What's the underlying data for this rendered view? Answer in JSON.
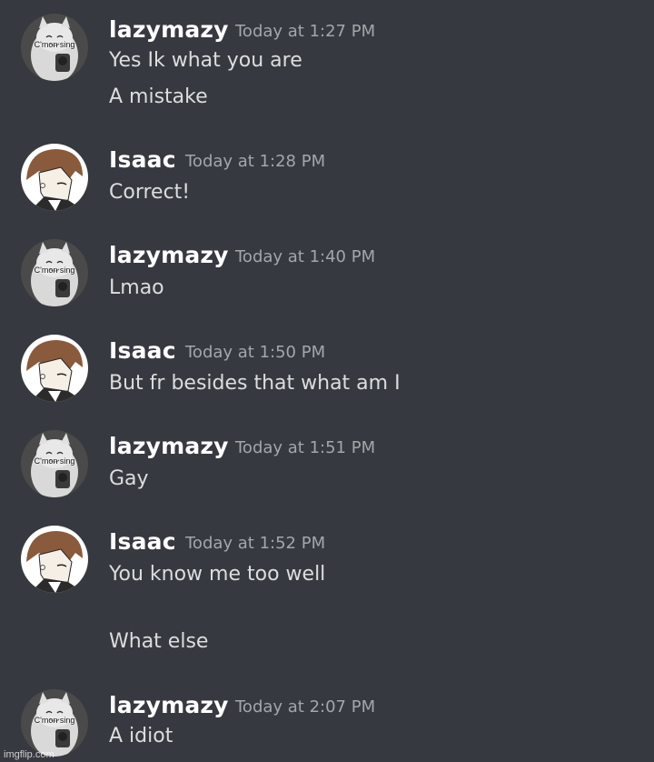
{
  "messages": [
    {
      "author": "lazymazy",
      "avatar": "cat-avatar",
      "time": "Today at 1:27 PM",
      "lines": [
        "Yes Ik what you are",
        "A mistake"
      ]
    },
    {
      "author": "Isaac",
      "avatar": "anime-avatar",
      "time": "Today at 1:28 PM",
      "lines": [
        "Correct!"
      ]
    },
    {
      "author": "lazymazy",
      "avatar": "cat-avatar",
      "time": "Today at 1:40 PM",
      "lines": [
        "Lmao"
      ]
    },
    {
      "author": "Isaac",
      "avatar": "anime-avatar",
      "time": "Today at 1:50 PM",
      "lines": [
        "But fr besides that what am I"
      ]
    },
    {
      "author": "lazymazy",
      "avatar": "cat-avatar",
      "time": "Today at 1:51 PM",
      "lines": [
        "Gay"
      ]
    },
    {
      "author": "Isaac",
      "avatar": "anime-avatar",
      "time": "Today at 1:52 PM",
      "lines": [
        "You know me too well",
        "What else"
      ]
    },
    {
      "author": "lazymazy",
      "avatar": "cat-avatar",
      "time": "Today at 2:07 PM",
      "lines": [
        "A idiot"
      ]
    }
  ],
  "avatar_caption": "C'mon sing",
  "watermark": "imgflip.com",
  "colors": {
    "background": "#36393f",
    "username": "#ffffff",
    "timestamp": "#a3a6aa",
    "message": "#dcddde"
  }
}
